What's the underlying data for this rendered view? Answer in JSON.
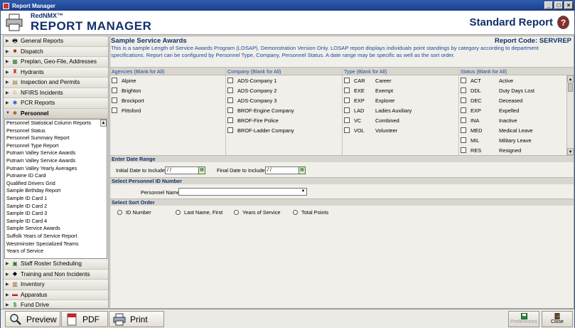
{
  "window": {
    "title": "Report Manager"
  },
  "header": {
    "brand_sub": "RedNMX™",
    "brand_main": "REPORT MANAGER",
    "report_type": "Standard Report"
  },
  "sidebar": {
    "items_top": [
      {
        "label": "General Reports",
        "icon": "printer-icon"
      },
      {
        "label": "Dispatch",
        "icon": "dispatch-icon"
      },
      {
        "label": "Preplan, Geo-File, Addresses",
        "icon": "map-icon"
      },
      {
        "label": "Hydrants",
        "icon": "hydrant-icon"
      },
      {
        "label": "Inspection and Permits",
        "icon": "clipboard-icon"
      },
      {
        "label": "NFIRS Incidents",
        "icon": "fire-icon"
      },
      {
        "label": "PCR Reports",
        "icon": "star-of-life-icon"
      }
    ],
    "active_item": {
      "label": "Personnel",
      "icon": "person-icon"
    },
    "subitems": [
      "Personnel Statistical Column Reports",
      "Personnel Status",
      "Personnel Summary Report",
      "Personnel Type Report",
      "Putnam Valley Service Awards",
      "Putnam Valley Service Awards",
      "Putnam Valley Yearly Averages",
      "Putname ID Card",
      "Qualified Drivers Grid",
      "Sample Birthday Report",
      "Sample ID Card 1",
      "Sample ID Card 2",
      "Sample ID Card 3",
      "Sample ID Card 4",
      "Sample Service Awards",
      "Suffolk Years of Service Report",
      "Westminster Specialized Teams",
      "Years of Service"
    ],
    "items_bottom": [
      {
        "label": "Staff Roster Scheduling",
        "icon": "calendar-icon"
      },
      {
        "label": "Training and Non Incidents",
        "icon": "graduation-cap-icon"
      },
      {
        "label": "Inventory",
        "icon": "inventory-icon"
      },
      {
        "label": "Apparatus",
        "icon": "truck-icon"
      },
      {
        "label": "Fund Drive",
        "icon": "dollar-icon"
      }
    ]
  },
  "report": {
    "title": "Sample Service Awards",
    "code": "Report Code: SERVREP",
    "description": "This is a sample Length of Service Awards Program (LOSAP).  Demonstration Version Only. LOSAP report displays individuals point standings by category according to department specifications.  Report can be configured by Personnel Type, Company, Personnel Status.  A date range may be specific as well as the sort order."
  },
  "filters": {
    "agencies": {
      "header": "Agencies (Blank for All)",
      "items": [
        "Alpine",
        "Brighton",
        "Brockport",
        "Pittsford"
      ]
    },
    "company": {
      "header": "Company (Blank for All)",
      "items": [
        "ADS-Company 1",
        "ADS-Company 2",
        "ADS-Company 3",
        "BROF-Engine Company",
        "BROF-Fire Police",
        "BROF-Ladder Company"
      ]
    },
    "type": {
      "header": "Type (Blank for All)",
      "items": [
        {
          "code": "CAR",
          "label": "Career"
        },
        {
          "code": "EXE",
          "label": "Exempt"
        },
        {
          "code": "EXP",
          "label": "Explorer"
        },
        {
          "code": "LAD",
          "label": "Ladies Auxiliary"
        },
        {
          "code": "VC",
          "label": "Combined"
        },
        {
          "code": "VOL",
          "label": "Volunteer"
        }
      ]
    },
    "status": {
      "header": "Status (Blank for All)",
      "items": [
        {
          "code": "ACT",
          "label": "Active"
        },
        {
          "code": "DDL",
          "label": "Duty Days Lost"
        },
        {
          "code": "DEC",
          "label": "Deceased"
        },
        {
          "code": "EXP",
          "label": "Expelled"
        },
        {
          "code": "INA",
          "label": "Inactive"
        },
        {
          "code": "MED",
          "label": "Medical Leave"
        },
        {
          "code": "MIL",
          "label": "Military Leave"
        },
        {
          "code": "RES",
          "label": "Resigned"
        }
      ]
    }
  },
  "date_range": {
    "header": "Enter Date Range",
    "initial_label": "Initial Date to Include",
    "initial_value": " / /",
    "final_label": "Final Date to Include",
    "final_value": " / /"
  },
  "personnel_select": {
    "header": "Select Personnel ID Number",
    "label": "Personnel Name",
    "value": ""
  },
  "sort_order": {
    "header": "Select Sort Order",
    "options": [
      "ID Number",
      "Last Name, First",
      "Years of Service",
      "Total Points"
    ]
  },
  "footer": {
    "preview": "Preview",
    "pdf": "PDF",
    "print": "Print",
    "preferences": "Preferences",
    "close": "Close"
  },
  "colors": {
    "accent": "#12306b",
    "description": "#1c4aa0",
    "titlebar": "#2a5cb4"
  }
}
